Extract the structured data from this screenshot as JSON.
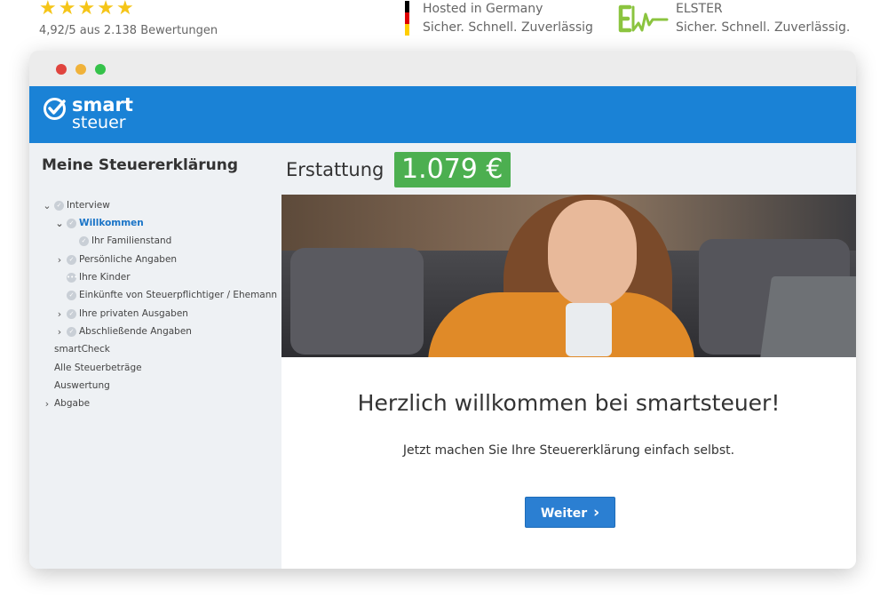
{
  "trust": {
    "rating_text": "4,92/5 aus 2.138 Bewertungen",
    "stars": 5,
    "hosted_title": "Hosted in Germany",
    "hosted_sub": "Sicher. Schnell. Zuverlässig",
    "elster_title": "ELSTER",
    "elster_sub": "Sicher. Schnell. Zuverlässig.",
    "flag_colors": [
      "#000000",
      "#dd0000",
      "#ffce00"
    ]
  },
  "window": {
    "dots": [
      "#e0443e",
      "#f0b23a",
      "#35c24a"
    ]
  },
  "brand": {
    "word1": "smart",
    "word2": "steuer",
    "color": "#1a82d6"
  },
  "sidebar": {
    "title": "Meine Steuererklärung",
    "items": [
      {
        "label": "Interview",
        "chevron": "down",
        "check": true,
        "level": 0
      },
      {
        "label": "Willkommen",
        "chevron": "down",
        "check": true,
        "level": 1,
        "active": true
      },
      {
        "label": "Ihr Familienstand",
        "chevron": "none",
        "check": true,
        "level": 2
      },
      {
        "label": "Persönliche Angaben",
        "chevron": "right",
        "check": true,
        "level": 1
      },
      {
        "label": "Ihre Kinder",
        "chevron": "none",
        "check": "dots",
        "level": 1
      },
      {
        "label": "Einkünfte von Steuerpflichtiger / Ehemann",
        "chevron": "none",
        "check": true,
        "level": 1
      },
      {
        "label": "Ihre privaten Ausgaben",
        "chevron": "right",
        "check": true,
        "level": 1
      },
      {
        "label": "Abschließende Angaben",
        "chevron": "right",
        "check": true,
        "level": 1
      },
      {
        "label": "smartCheck",
        "chevron": "none",
        "check": false,
        "level": 0
      },
      {
        "label": "Alle Steuerbeträge",
        "chevron": "none",
        "check": false,
        "level": 0
      },
      {
        "label": "Auswertung",
        "chevron": "none",
        "check": false,
        "level": 0
      },
      {
        "label": "Abgabe",
        "chevron": "right",
        "check": false,
        "level": 0
      }
    ]
  },
  "refund": {
    "label": "Erstattung",
    "amount": "1.079 €",
    "color": "#4caf50"
  },
  "main": {
    "welcome": "Herzlich willkommen bei smartsteuer!",
    "subtitle": "Jetzt machen Sie Ihre Steuererklärung einfach selbst.",
    "button_label": "Weiter",
    "button_icon": "chevron-right-icon"
  }
}
